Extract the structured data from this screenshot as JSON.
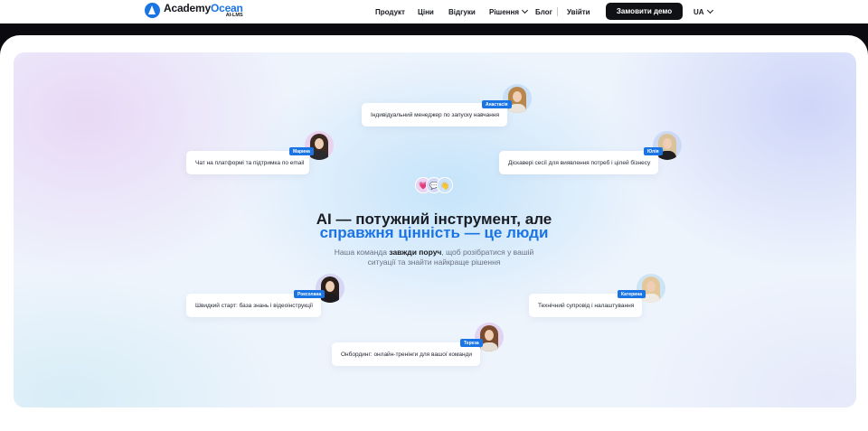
{
  "header": {
    "logo": {
      "name_part1": "Academy",
      "name_part2": "Ocean",
      "sub": "AI-LMS"
    },
    "nav": {
      "product": "Продукт",
      "prices": "Ціни",
      "reviews": "Відгуки",
      "solutions": "Рішення",
      "blog": "Блог",
      "login": "Увійти"
    },
    "demo_button": "Замовити демо",
    "language": "UA"
  },
  "center": {
    "title_line1": "AI — потужний інструмент, але",
    "title_line2": "справжня цінність — це люди",
    "subtitle_pre": "Наша команда ",
    "subtitle_bold": "завжди поруч",
    "subtitle_post": ", щоб розібратися у вашій ситуації та знайти найкраще рішення",
    "bubbles": [
      "💗",
      "💬",
      "👋"
    ]
  },
  "cards": [
    {
      "text": "Індивідуальний менеджер по запуску навчання",
      "name": "Анастасія"
    },
    {
      "text": "Чат на платформі та підтримка по email",
      "name": "Марина"
    },
    {
      "text": "Діскавері сесії для виявлення потреб і цілей бізнесу",
      "name": "Юлія"
    },
    {
      "text": "Швидкий старт: база знань і відеоінструкції",
      "name": "Роксолана"
    },
    {
      "text": "Технічний супровід і налаштування",
      "name": "Катерина"
    },
    {
      "text": "Онбординг: онлайн-тренінги для вашої команди",
      "name": "Тереза"
    }
  ],
  "colors": {
    "accent": "#1b74e4",
    "dark": "#101114"
  }
}
